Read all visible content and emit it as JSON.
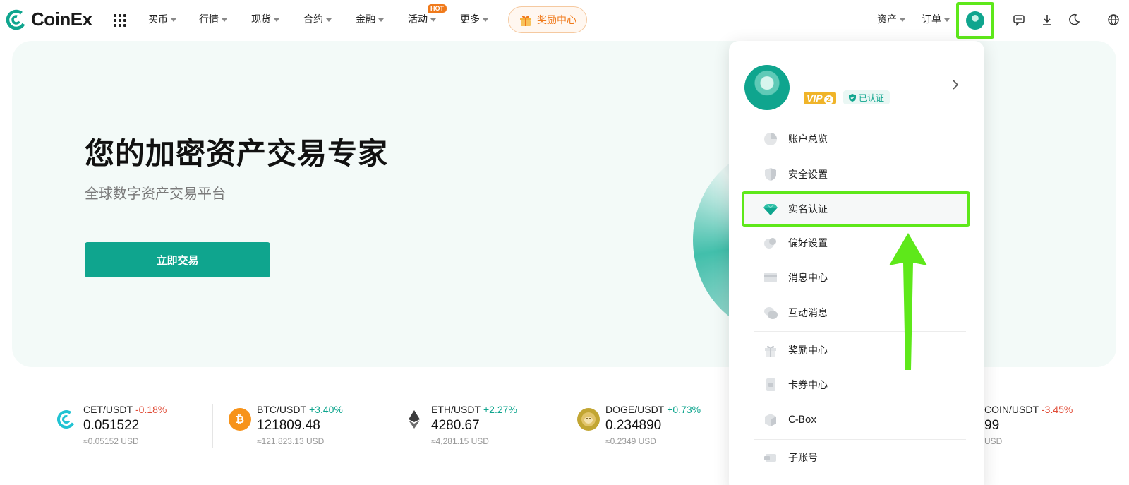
{
  "brand": {
    "name": "CoinEx",
    "color": "#0fa58e"
  },
  "nav": [
    {
      "label": "买币",
      "caret": true
    },
    {
      "label": "行情",
      "caret": true
    },
    {
      "label": "现货",
      "caret": true
    },
    {
      "label": "合约",
      "caret": true
    },
    {
      "label": "金融",
      "caret": true
    },
    {
      "label": "活动",
      "caret": true,
      "badge": "HOT"
    },
    {
      "label": "更多",
      "caret": true
    }
  ],
  "reward_pill": {
    "label": "奖励中心",
    "icon": "gift-icon"
  },
  "header_right": {
    "assets": "资产",
    "orders": "订单"
  },
  "header_icons": [
    "avatar-icon",
    "message-icon",
    "download-icon",
    "moon-icon",
    "globe-icon"
  ],
  "hero": {
    "title": "您的加密资产交易专家",
    "subtitle": "全球数字资产交易平台",
    "cta": "立即交易"
  },
  "ticker": [
    {
      "pair": "CET/USDT",
      "change": "-0.18%",
      "price": "0.051522",
      "usd": "≈0.05152 USD",
      "icon": "cet-coin-icon",
      "color": "#20c3d3"
    },
    {
      "pair": "BTC/USDT",
      "change": "+3.40%",
      "price": "121809.48",
      "usd": "≈121,823.13 USD",
      "icon": "bitcoin-icon",
      "color": "#f7931a"
    },
    {
      "pair": "ETH/USDT",
      "change": "+2.27%",
      "price": "4280.67",
      "usd": "≈4,281.15 USD",
      "icon": "ethereum-icon",
      "color": "#3c3c3d"
    },
    {
      "pair": "DOGE/USDT",
      "change": "+0.73%",
      "price": "0.234890",
      "usd": "≈0.2349 USD",
      "icon": "dogecoin-icon",
      "color": "#c2a633"
    },
    {
      "pair": "COIN/USDT",
      "change": "-3.45%",
      "price": "99",
      "usd": "USD",
      "icon": "coin-icon",
      "color": "#888888"
    }
  ],
  "dropdown": {
    "vip_label": "VIP",
    "vip_level": "2",
    "verified_label": "已认证",
    "items": [
      {
        "label": "账户总览",
        "icon": "pie-chart-icon"
      },
      {
        "label": "安全设置",
        "icon": "shield-icon"
      },
      {
        "label": "实名认证",
        "icon": "diamond-icon",
        "highlighted": true
      },
      {
        "label": "偏好设置",
        "icon": "preferences-icon"
      },
      {
        "label": "消息中心",
        "icon": "mail-icon"
      },
      {
        "label": "互动消息",
        "icon": "chat-bubbles-icon"
      },
      {
        "label": "奖励中心",
        "icon": "gift-icon"
      },
      {
        "label": "卡券中心",
        "icon": "coupon-icon"
      },
      {
        "label": "C-Box",
        "icon": "box-icon"
      },
      {
        "label": "子账号",
        "icon": "sub-account-icon"
      }
    ]
  },
  "annotation": {
    "color": "#5ee81a"
  }
}
